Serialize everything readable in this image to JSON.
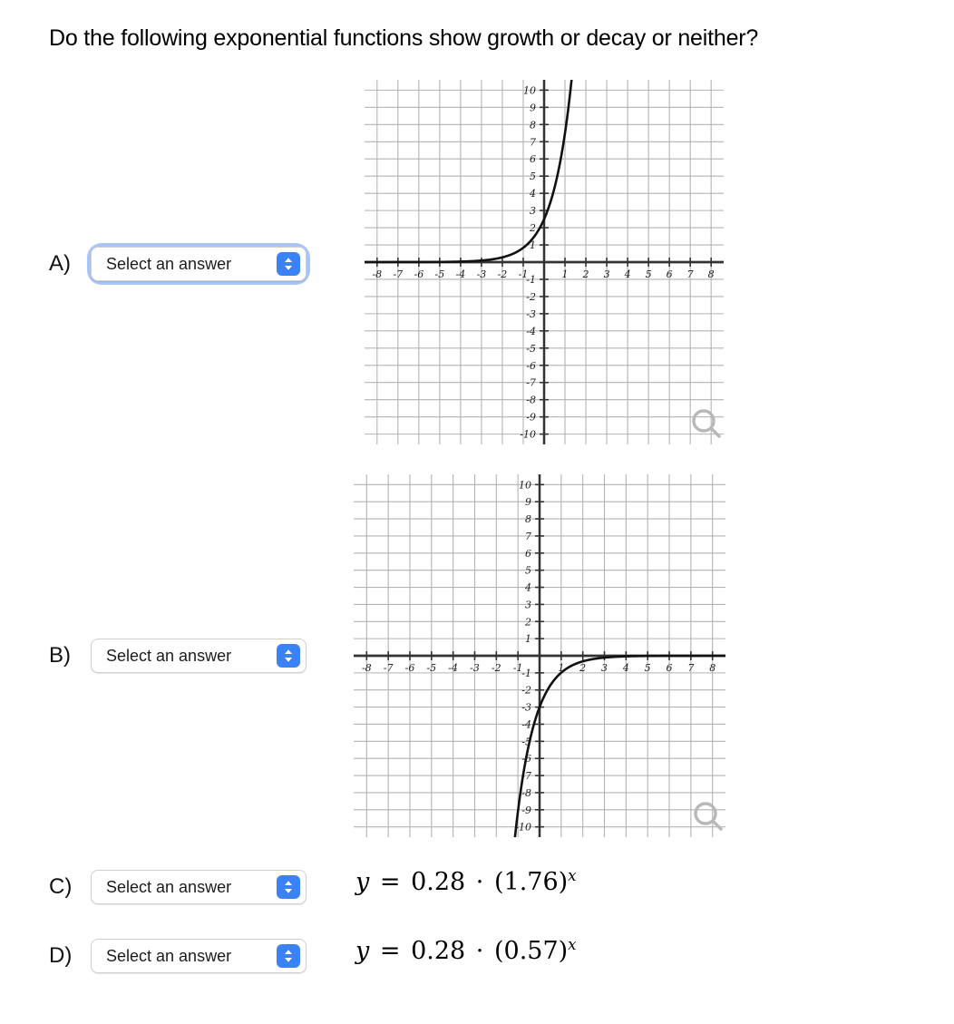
{
  "question": {
    "title": "Do the following exponential functions show growth or decay or neither?"
  },
  "select_placeholder": "Select an answer",
  "answers": [
    {
      "letter": "A)",
      "value": "Select an answer",
      "focused": true
    },
    {
      "letter": "B)",
      "value": "Select an answer",
      "focused": false
    },
    {
      "letter": "C)",
      "value": "Select an answer",
      "focused": false
    },
    {
      "letter": "D)",
      "value": "Select an answer",
      "focused": false
    }
  ],
  "equations": {
    "c": {
      "lhs": "y",
      "eq": "=",
      "coefficient": "0.28",
      "dot": "·",
      "base": "(1.76)",
      "exponent": "x"
    },
    "d": {
      "lhs": "y",
      "eq": "=",
      "coefficient": "0.28",
      "dot": "·",
      "base": "(0.57)",
      "exponent": "x"
    }
  },
  "icons": {
    "stepper": "chevron-up-down-icon",
    "magnifier": "magnifier-icon"
  },
  "colors": {
    "accent_blue": "#3b82f6",
    "focus_ring": "#a9c5f7",
    "grid_minor": "#b3b3b3",
    "grid_major": "#808080",
    "axis": "#333333",
    "curve": "#111111",
    "magnifier": "#b8b8b8"
  },
  "chart_data": [
    {
      "id": "graph-a",
      "type": "line",
      "title": "",
      "xlabel": "",
      "ylabel": "",
      "xlim": [
        -8.6,
        8.6
      ],
      "ylim": [
        -10.6,
        10.6
      ],
      "xticks": [
        -8,
        -7,
        -6,
        -5,
        -4,
        -3,
        -2,
        -1,
        1,
        2,
        3,
        4,
        5,
        6,
        7,
        8
      ],
      "yticks": [
        10,
        9,
        8,
        7,
        6,
        5,
        4,
        3,
        2,
        1,
        -1,
        -2,
        -3,
        -4,
        -5,
        -6,
        -7,
        -8,
        -9,
        -10
      ],
      "grid": true,
      "legend": "none",
      "description": "exponential growth curve",
      "function": "y = 2.5 * 3^x",
      "a": 2.5,
      "b": 3.0,
      "points": [
        {
          "x": -8,
          "y": 0.0
        },
        {
          "x": -6,
          "y": 0.003
        },
        {
          "x": -4,
          "y": 0.031
        },
        {
          "x": -3,
          "y": 0.093
        },
        {
          "x": -2,
          "y": 0.278
        },
        {
          "x": -1,
          "y": 0.833
        },
        {
          "x": 0,
          "y": 2.5
        },
        {
          "x": 0.5,
          "y": 4.33
        },
        {
          "x": 1,
          "y": 7.5
        },
        {
          "x": 1.25,
          "y": 9.87
        }
      ]
    },
    {
      "id": "graph-b",
      "type": "line",
      "title": "",
      "xlabel": "",
      "ylabel": "",
      "xlim": [
        -8.6,
        8.6
      ],
      "ylim": [
        -10.6,
        10.6
      ],
      "xticks": [
        -8,
        -7,
        -6,
        -5,
        -4,
        -3,
        -2,
        -1,
        1,
        2,
        3,
        4,
        5,
        6,
        7,
        8
      ],
      "yticks": [
        10,
        9,
        8,
        7,
        6,
        5,
        4,
        3,
        2,
        1,
        -1,
        -2,
        -3,
        -4,
        -5,
        -6,
        -7,
        -8,
        -9,
        -10
      ],
      "grid": true,
      "legend": "none",
      "description": "reflected decay curve approaching x-axis from below",
      "function": "y = -3 * 0.33^x",
      "a": -3.0,
      "b": 0.33,
      "points": [
        {
          "x": -1.05,
          "y": -10.6
        },
        {
          "x": -1,
          "y": -9.09
        },
        {
          "x": -0.5,
          "y": -5.22
        },
        {
          "x": 0,
          "y": -3.0
        },
        {
          "x": 0.5,
          "y": -1.72
        },
        {
          "x": 1,
          "y": -0.99
        },
        {
          "x": 2,
          "y": -0.33
        },
        {
          "x": 3,
          "y": -0.11
        },
        {
          "x": 4,
          "y": -0.036
        },
        {
          "x": 6,
          "y": -0.004
        },
        {
          "x": 8,
          "y": 0.0
        }
      ]
    }
  ]
}
